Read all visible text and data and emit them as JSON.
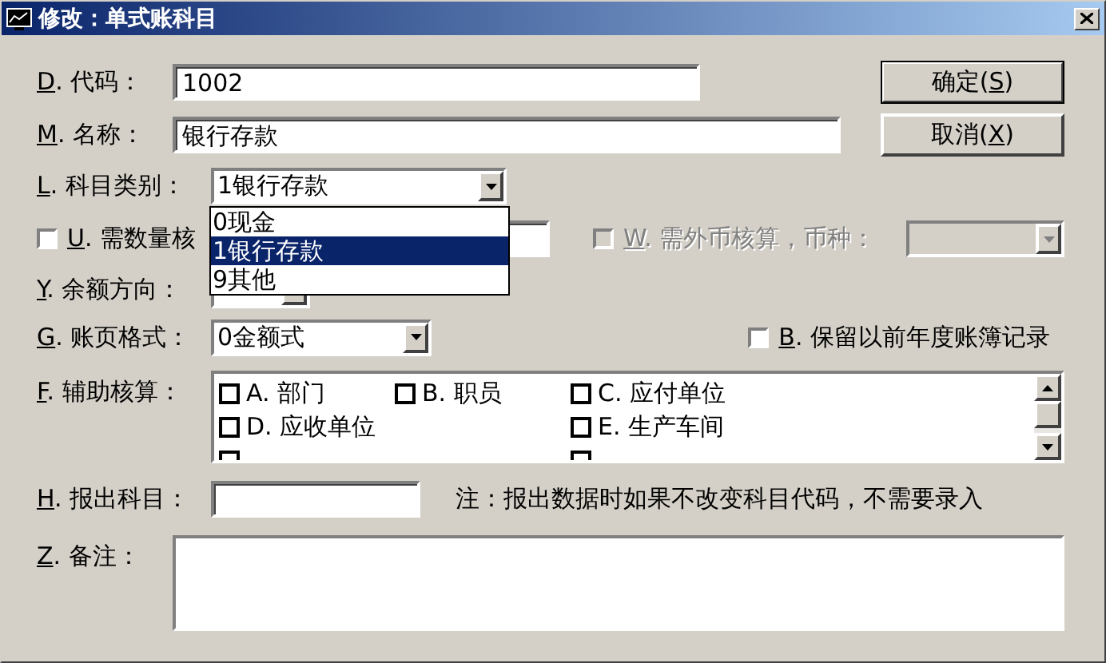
{
  "window": {
    "title": "修改：单式账科目"
  },
  "code": {
    "key": "D",
    "label": ". 代码：",
    "value": "1002"
  },
  "name": {
    "key": "M",
    "label": ". 名称：",
    "value": "银行存款"
  },
  "buttons": [
    {
      "before": "确定(",
      "key": "S",
      "after": ")",
      "default": true
    },
    {
      "before": "取消(",
      "key": "X",
      "after": ")",
      "default": false
    }
  ],
  "category": {
    "key": "L",
    "label": ". 科目类别：",
    "value": "1银行存款",
    "expanded": true,
    "options": [
      {
        "label": "0现金",
        "selected": false
      },
      {
        "label": "1银行存款",
        "selected": true
      },
      {
        "label": "9其他",
        "selected": false
      }
    ]
  },
  "quantity": {
    "key": "U",
    "label": ". 需数量核",
    "checked": false
  },
  "foreign": {
    "key": "W",
    "label": ". 需外币核算，币种：",
    "checked": false,
    "disabled": true
  },
  "balance": {
    "key": "Y",
    "label": ". 余额方向："
  },
  "page_format": {
    "key": "G",
    "label": ". 账页格式：",
    "value": "0金额式"
  },
  "keep_records": {
    "key": "B",
    "label": ". 保留以前年度账簿记录",
    "checked": false
  },
  "auxiliary": {
    "key": "F",
    "label": ". 辅助核算：",
    "columns": [
      {
        "items": [
          {
            "label": "A. 部门",
            "checked": false
          },
          {
            "label": "D. 应收单位",
            "checked": false
          },
          {
            "checked": false
          }
        ]
      },
      {
        "items": [
          {
            "label": "B. 职员",
            "checked": false
          }
        ]
      },
      {
        "items": [
          {
            "label": "C. 应付单位",
            "checked": false
          },
          {
            "label": "E. 生产车间",
            "checked": false
          },
          {
            "checked": false
          }
        ]
      }
    ]
  },
  "report": {
    "key": "H",
    "label": ". 报出科目：",
    "note": "注：报出数据时如果不改变科目代码，不需要录入"
  },
  "memo": {
    "key": "Z",
    "label": ". 备注："
  }
}
